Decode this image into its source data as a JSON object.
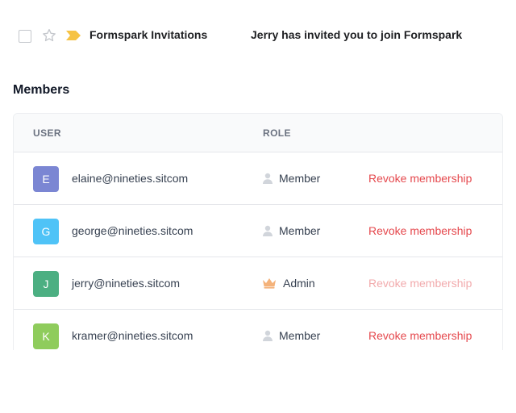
{
  "email": {
    "sender": "Formspark Invitations",
    "subject": "Jerry has invited you to join Formspark",
    "label_color": "#f6c344"
  },
  "members": {
    "title": "Members",
    "columns": {
      "user": "USER",
      "role": "ROLE"
    },
    "rows": [
      {
        "initial": "E",
        "email": "elaine@nineties.sitcom",
        "role": "Member",
        "role_icon": "user-icon",
        "avatar_color": "#7b86d3",
        "action": "Revoke membership",
        "action_enabled": true
      },
      {
        "initial": "G",
        "email": "george@nineties.sitcom",
        "role": "Member",
        "role_icon": "user-icon",
        "avatar_color": "#4fc3f7",
        "action": "Revoke membership",
        "action_enabled": true
      },
      {
        "initial": "J",
        "email": "jerry@nineties.sitcom",
        "role": "Admin",
        "role_icon": "crown-icon",
        "avatar_color": "#4caf82",
        "action": "Revoke membership",
        "action_enabled": false
      },
      {
        "initial": "K",
        "email": "kramer@nineties.sitcom",
        "role": "Member",
        "role_icon": "user-icon",
        "avatar_color": "#8fcc5c",
        "action": "Revoke membership",
        "action_enabled": true
      }
    ]
  },
  "colors": {
    "revoke": "#e5484d",
    "revoke_disabled": "#f2aaac",
    "admin_crown": "#f4b27a",
    "member_icon": "#d1d5db"
  }
}
